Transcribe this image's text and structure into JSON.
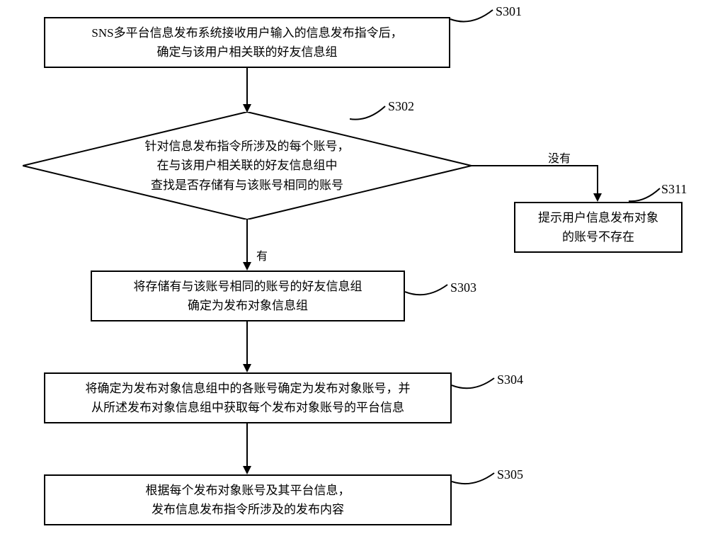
{
  "chart_data": {
    "type": "flowchart",
    "nodes": [
      {
        "id": "S301",
        "type": "process",
        "text": "SNS多平台信息发布系统接收用户输入的信息发布指令后，\n确定与该用户相关联的好友信息组"
      },
      {
        "id": "S302",
        "type": "decision",
        "text": "针对信息发布指令所涉及的每个账号，\n在与该用户相关联的好友信息组中\n查找是否存储有与该账号相同的账号"
      },
      {
        "id": "S303",
        "type": "process",
        "text": "将存储有与该账号相同的账号的好友信息组\n确定为发布对象信息组"
      },
      {
        "id": "S304",
        "type": "process",
        "text": "将确定为发布对象信息组中的各账号确定为发布对象账号，并\n从所述发布对象信息组中获取每个发布对象账号的平台信息"
      },
      {
        "id": "S305",
        "type": "process",
        "text": "根据每个发布对象账号及其平台信息，\n发布信息发布指令所涉及的发布内容"
      },
      {
        "id": "S311",
        "type": "process",
        "text": "提示用户信息发布对象\n的账号不存在"
      }
    ],
    "edges": [
      {
        "from": "S301",
        "to": "S302"
      },
      {
        "from": "S302",
        "to": "S303",
        "label": "有"
      },
      {
        "from": "S302",
        "to": "S311",
        "label": "没有"
      },
      {
        "from": "S303",
        "to": "S304"
      },
      {
        "from": "S304",
        "to": "S305"
      }
    ]
  },
  "labels": {
    "S301": "S301",
    "S302": "S302",
    "S303": "S303",
    "S304": "S304",
    "S305": "S305",
    "S311": "S311"
  },
  "edge_labels": {
    "yes": "有",
    "no": "没有"
  }
}
